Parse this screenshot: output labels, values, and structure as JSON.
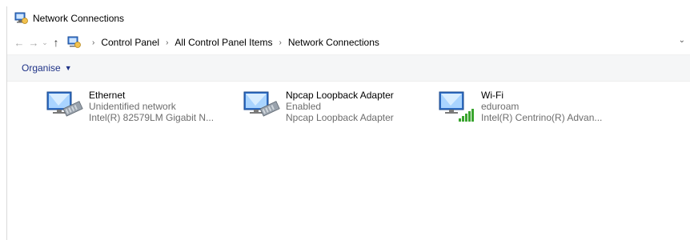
{
  "window": {
    "title": "Network Connections",
    "icon": "network-connections-icon"
  },
  "nav": {
    "back": "←",
    "forward": "→",
    "recent": "⌄",
    "up": "↑"
  },
  "address": {
    "items": [
      "Control Panel",
      "All Control Panel Items",
      "Network Connections"
    ],
    "separator": "›",
    "dropdown": "⌄"
  },
  "toolbar": {
    "organise_label": "Organise",
    "organise_caret": "▼"
  },
  "connections": [
    {
      "name": "Ethernet",
      "status": "Unidentified network",
      "device": "Intel(R) 82579LM Gigabit N...",
      "icon": "ethernet-adapter-icon"
    },
    {
      "name": "Npcap Loopback Adapter",
      "status": "Enabled",
      "device": "Npcap Loopback Adapter",
      "icon": "loopback-adapter-icon"
    },
    {
      "name": "Wi-Fi",
      "status": "eduroam",
      "device": "Intel(R) Centrino(R) Advan...",
      "icon": "wifi-adapter-icon"
    }
  ],
  "colors": {
    "toolbar_bg": "#f5f6f7",
    "organise_text": "#1e3287",
    "secondary_text": "#6d6d6d",
    "wifi_signal": "#3aa52f"
  }
}
